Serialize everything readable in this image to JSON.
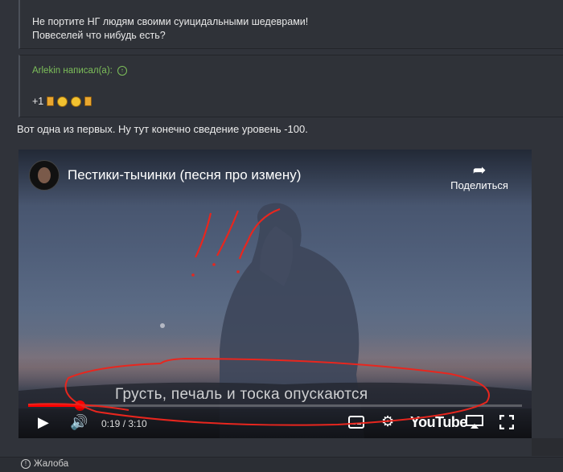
{
  "prev_quote": {
    "line1": "Не портите НГ людям своими суицидальными шедеврами!",
    "line2": "Повеселей что нибудь есть?"
  },
  "quote": {
    "author": "Arlekin написал(а):",
    "text": "+1"
  },
  "post_text": "Вот одна из первых. Ну тут конечно сведение уровень -100.",
  "video": {
    "title": "Пестики-тычинки (песня про измену)",
    "share_label": "Поделиться",
    "subtitle": "Грусть, печаль и тоска опускаются",
    "time": "0:19 / 3:10",
    "brand": "YouTube",
    "progress": 0.105
  },
  "footer": {
    "report_label": "Жалоба"
  },
  "colors": {
    "accent_green": "#7dbf5a",
    "progress_red": "#ff0000",
    "annotation_red": "#e8261e"
  }
}
